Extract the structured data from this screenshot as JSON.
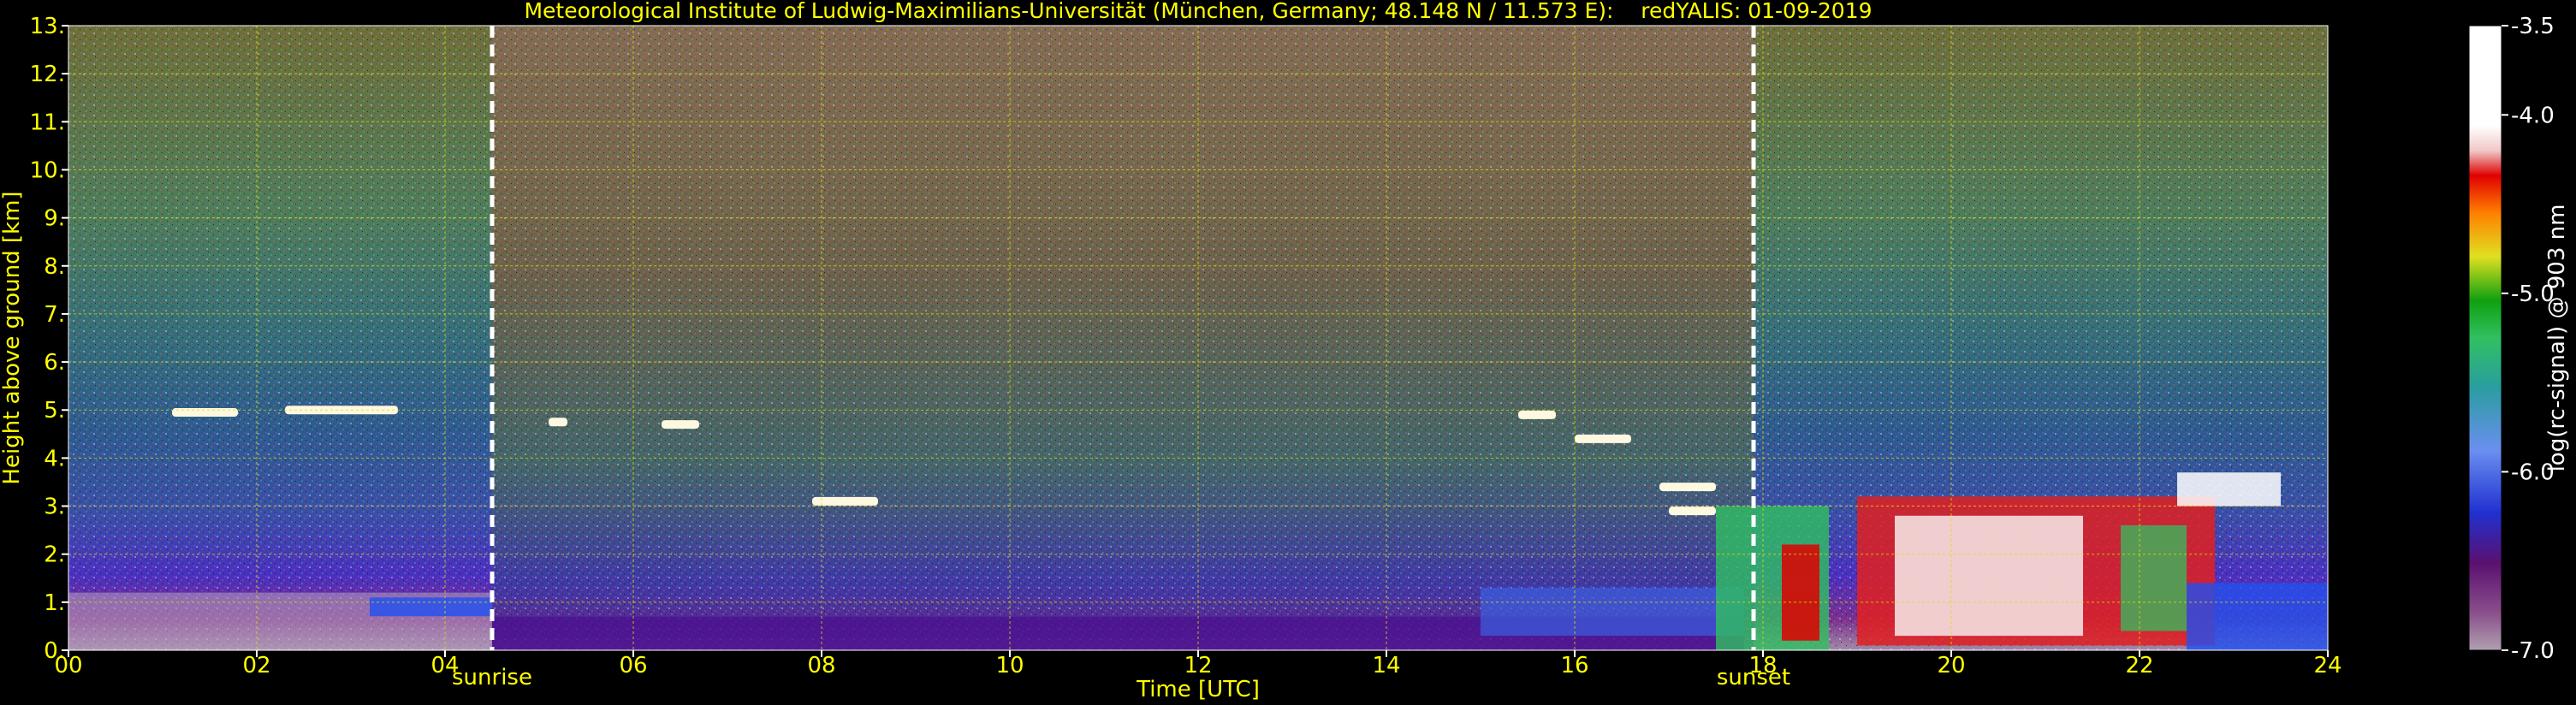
{
  "chart_data": {
    "type": "heatmap",
    "title": "Meteorological Institute of Ludwig-Maximilians-Universität (München, Germany; 48.148 N / 11.573 E):    redYALIS: 01-09-2019",
    "xlabel": "Time [UTC]",
    "ylabel": "Height above ground [km]",
    "xlim": [
      0,
      24
    ],
    "ylim": [
      0,
      13
    ],
    "x_ticks": [
      "00",
      "02",
      "04",
      "06",
      "08",
      "10",
      "12",
      "14",
      "16",
      "18",
      "20",
      "22",
      "24"
    ],
    "y_ticks": [
      "0.",
      "1.",
      "2.",
      "3.",
      "4.",
      "5.",
      "6.",
      "7.",
      "8.",
      "9.",
      "10.",
      "11.",
      "12.",
      "13."
    ],
    "grid": true,
    "colorbar": {
      "label": "log(rc-signal) @ 903 nm",
      "range": [
        -7.0,
        -3.5
      ],
      "ticks": [
        "-3.5",
        "-4.0",
        "-5.0",
        "-6.0",
        "-7.0"
      ]
    },
    "annotations": [
      {
        "text": "sunrise",
        "x": 4.5
      },
      {
        "text": "sunset",
        "x": 17.9
      }
    ],
    "cloud_layers": [
      {
        "t0": 1.1,
        "t1": 1.8,
        "h": 4.95
      },
      {
        "t0": 2.3,
        "t1": 3.5,
        "h": 5.0
      },
      {
        "t0": 5.1,
        "t1": 5.3,
        "h": 4.75
      },
      {
        "t0": 6.3,
        "t1": 6.7,
        "h": 4.7
      },
      {
        "t0": 7.9,
        "t1": 8.6,
        "h": 3.1
      },
      {
        "t0": 15.4,
        "t1": 15.8,
        "h": 4.9
      },
      {
        "t0": 16.0,
        "t1": 16.6,
        "h": 4.4
      },
      {
        "t0": 16.9,
        "t1": 17.5,
        "h": 3.4
      },
      {
        "t0": 17.0,
        "t1": 17.5,
        "h": 2.9
      }
    ],
    "color_stops": [
      "#b0a0b0",
      "#8a4f8c",
      "#5a1070",
      "#2030d0",
      "#6a8ff0",
      "#2a9da0",
      "#30c060",
      "#10a010",
      "#e0e020",
      "#ff8000",
      "#e00000",
      "#f0c8c8",
      "#ffffff"
    ]
  }
}
